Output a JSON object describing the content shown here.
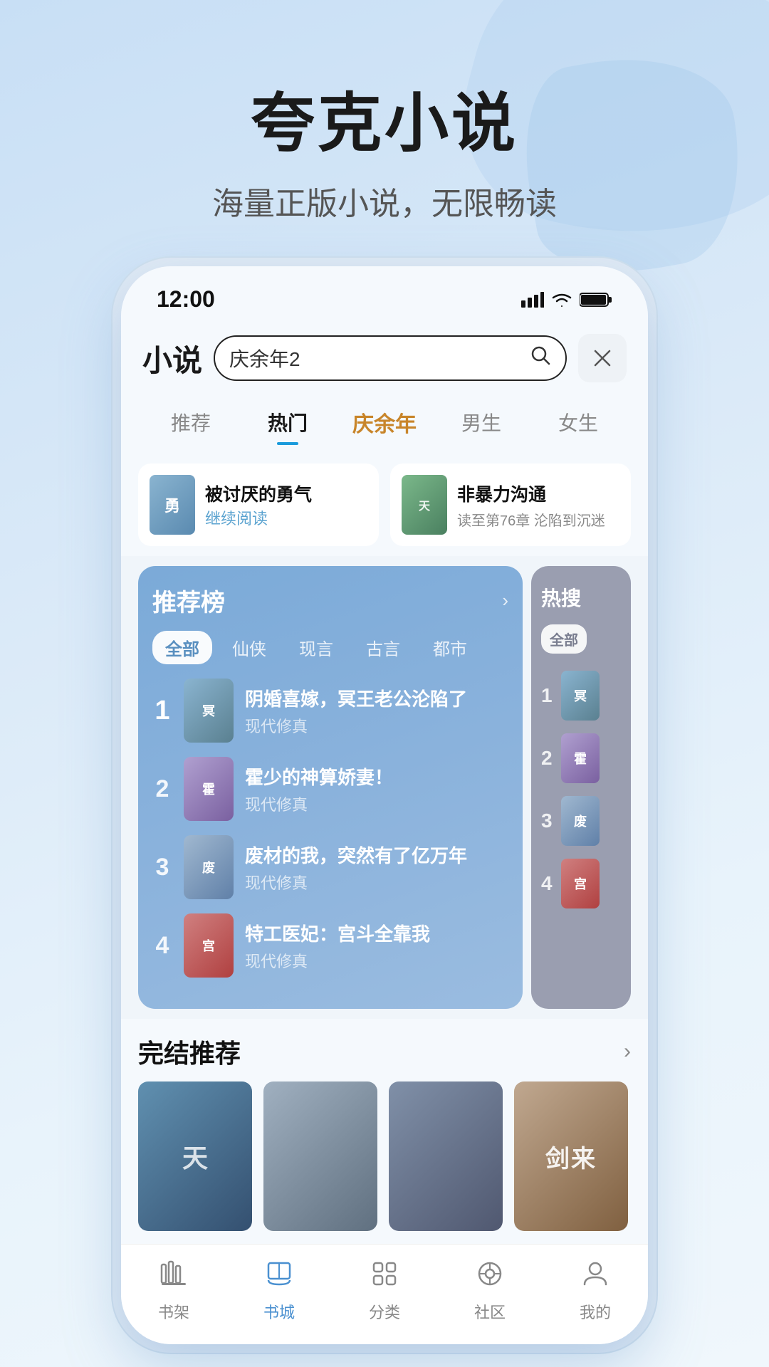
{
  "app": {
    "title": "夸克小说",
    "subtitle": "海量正版小说，无限畅读"
  },
  "status_bar": {
    "time": "12:00"
  },
  "header": {
    "logo": "小说",
    "search_placeholder": "庆余年2",
    "close_label": "×"
  },
  "tabs": [
    {
      "id": "recommend",
      "label": "推荐",
      "active": false
    },
    {
      "id": "hot",
      "label": "热门",
      "active": true
    },
    {
      "id": "special",
      "label": "庆余年",
      "active": false,
      "special": true
    },
    {
      "id": "male",
      "label": "男生",
      "active": false
    },
    {
      "id": "female",
      "label": "女生",
      "active": false
    }
  ],
  "recent_books": [
    {
      "title": "被讨厌的勇气",
      "action": "继续阅读",
      "progress": "",
      "cover_class": "cover-1",
      "cover_text": "勇"
    },
    {
      "title": "非暴力沟通",
      "action": "",
      "progress": "读至第76章 沦陷到沉迷",
      "cover_class": "cover-2",
      "cover_text": "天"
    }
  ],
  "recommend_panel": {
    "title": "推荐榜",
    "arrow": "›",
    "filters": [
      "全部",
      "仙侠",
      "现言",
      "古言",
      "都市"
    ],
    "active_filter": "全部",
    "books": [
      {
        "rank": "1",
        "title": "阴婚喜嫁，冥王老公沦陷了",
        "genre": "现代修真",
        "cover_class": "cr-1",
        "cover_text": "冥"
      },
      {
        "rank": "2",
        "title": "霍少的神算娇妻！",
        "genre": "现代修真",
        "cover_class": "cr-2",
        "cover_text": "霍"
      },
      {
        "rank": "3",
        "title": "废材的我，突然有了亿万年",
        "genre": "现代修真",
        "cover_class": "cr-3",
        "cover_text": "废"
      },
      {
        "rank": "4",
        "title": "特工医妃：宫斗全靠我",
        "genre": "现代修真",
        "cover_class": "cr-4",
        "cover_text": "宫"
      }
    ]
  },
  "hot_panel": {
    "title": "热搜",
    "filter": "全部",
    "items": [
      {
        "rank": "1",
        "cover_class": "hc-1",
        "cover_text": "冥"
      },
      {
        "rank": "2",
        "cover_class": "hc-2",
        "cover_text": "霍"
      },
      {
        "rank": "3",
        "cover_class": "hc-3",
        "cover_text": "废"
      },
      {
        "rank": "4",
        "cover_class": "hc-4",
        "cover_text": "宫"
      }
    ]
  },
  "completed_section": {
    "title": "完结推荐",
    "arrow": "›",
    "books": [
      {
        "cover_class": "cc-1",
        "cover_text": "天",
        "title": ""
      },
      {
        "cover_class": "cc-2",
        "cover_text": "",
        "title": ""
      },
      {
        "cover_class": "cc-3",
        "cover_text": "",
        "title": ""
      },
      {
        "cover_class": "cc-4",
        "cover_text": "剑来",
        "title": ""
      }
    ]
  },
  "bottom_nav": [
    {
      "id": "bookshelf",
      "label": "书架",
      "icon": "bookshelf",
      "active": false
    },
    {
      "id": "bookstore",
      "label": "书城",
      "icon": "bookstore",
      "active": true
    },
    {
      "id": "category",
      "label": "分类",
      "icon": "category",
      "active": false
    },
    {
      "id": "community",
      "label": "社区",
      "icon": "community",
      "active": false
    },
    {
      "id": "profile",
      "label": "我的",
      "icon": "profile",
      "active": false
    }
  ]
}
